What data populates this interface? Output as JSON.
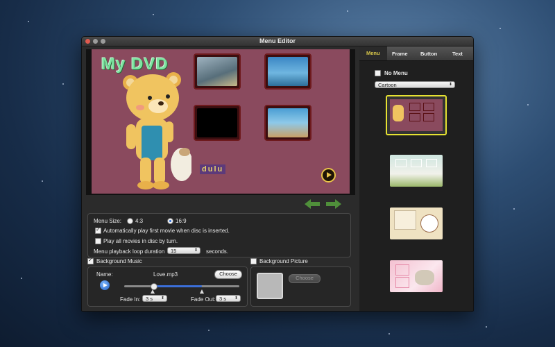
{
  "window": {
    "title": "Menu Editor"
  },
  "preview": {
    "dvd_title": "My DVD",
    "sticker_text": "dulu"
  },
  "menu_settings": {
    "size_label": "Menu Size:",
    "ratio_options": [
      "4:3",
      "16:9"
    ],
    "selected_ratio": "16:9",
    "auto_play_label": "Automatically play first movie when disc is inserted.",
    "auto_play_checked": true,
    "play_all_label": "Play all movies in disc by turn.",
    "play_all_checked": false,
    "loop_label": "Menu playback loop duration",
    "loop_value": "15",
    "loop_unit": "seconds."
  },
  "bg_music": {
    "label": "Background Music",
    "checked": true,
    "name_label": "Name:",
    "file": "Love.mp3",
    "choose_label": "Choose",
    "fade_in_label": "Fade In:",
    "fade_in_value": "3 s",
    "fade_out_label": "Fade Out:",
    "fade_out_value": "3 s"
  },
  "bg_picture": {
    "label": "Background Picture",
    "checked": false,
    "choose_label": "Choose"
  },
  "tabs": [
    "Menu",
    "Frame",
    "Button",
    "Text"
  ],
  "active_tab": "Menu",
  "template_panel": {
    "no_menu_label": "No Menu",
    "no_menu_checked": false,
    "theme_value": "Cartoon"
  },
  "colors": {
    "accent": "#e6e232",
    "canvas": "#8a4a5e",
    "frame": "#6e1a1d"
  }
}
